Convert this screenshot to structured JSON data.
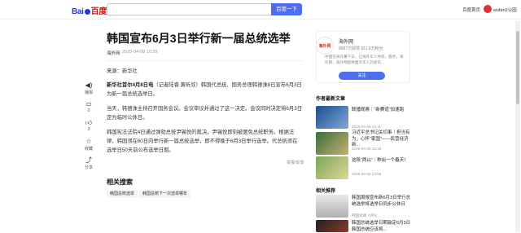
{
  "header": {
    "logo_text_1": "Bai",
    "logo_text_2": "百度",
    "search_value": "",
    "search_button": "百度一下",
    "homepage_link": "百度首页",
    "username": "wufan2公园"
  },
  "article": {
    "title": "韩国宣布6月3日举行新一届总统选举",
    "source": "海外网",
    "date": "2025-04-08 10:39",
    "paragraphs": {
      "p1": "来源：新华社",
      "p2_bold": "新华社首尔4月8日电",
      "p2_rest": "（记者陆睿 黄昕欣）韩国代总统、国务总理韩德洙8日宣布6月3日为新一届总统选举日。",
      "p3": "当天，韩德洙主持召开国务会议。会议审议并通过了这一决定。会议同时决定将6月3日定为临时公休日。",
      "p4": "韩国宪法法院4日通过弹劾总统尹锡悦的裁决，尹锡悦即刻被罢免总统职务。根据法律，韩国须在60日内举行新一届总统选举，即不得晚于6月3日举行选举。代总统须在选举日50天前公布选举日期。"
    },
    "report_link": "举报/反馈"
  },
  "side_actions": {
    "listen": "播报",
    "comment_count": "0",
    "like_count": "3",
    "favorite": "收藏",
    "share": "分享"
  },
  "related_search": {
    "heading": "相关搜索",
    "tags": [
      "韩国总统选举",
      "韩国总统下一次选举哪年"
    ]
  },
  "author": {
    "logo_text": "海外网",
    "name": "海外网",
    "fans": "8687万获赞 811.8万粉丝",
    "desc": "中国在海外覆下去，让海外华人共同，服务，海外网，海外网提供国外华人的资讯...",
    "follow_button": "关注"
  },
  "author_articles": {
    "heading": "作者最新文章",
    "items": [
      {
        "title": "联播观察｜“新赛道”加速跑",
        "meta": "2025-04-08 16:11"
      },
      {
        "title": "习近平总书记关切事｜担当有为，心怀“家国”——民营经济新...",
        "meta": "2025-04-08 15:33"
      },
      {
        "title": "这段“两山”｜种出一个春天！",
        "meta": "2025-04-08 14:56"
      }
    ]
  },
  "recommend": {
    "heading": "相关推荐",
    "items": [
      {
        "title": "韩国周报宣布新6月3日举行总统选举将选举日同步公休日",
        "meta": "韩国新闻 1评论"
      },
      {
        "title": "韩国总统选举日期敲定6月3日韩国总统应该将...",
        "meta": ""
      }
    ]
  },
  "colors": {
    "accent": "#4e6ef2",
    "brand_red": "#e10602",
    "brand_blue": "#2932e1"
  }
}
